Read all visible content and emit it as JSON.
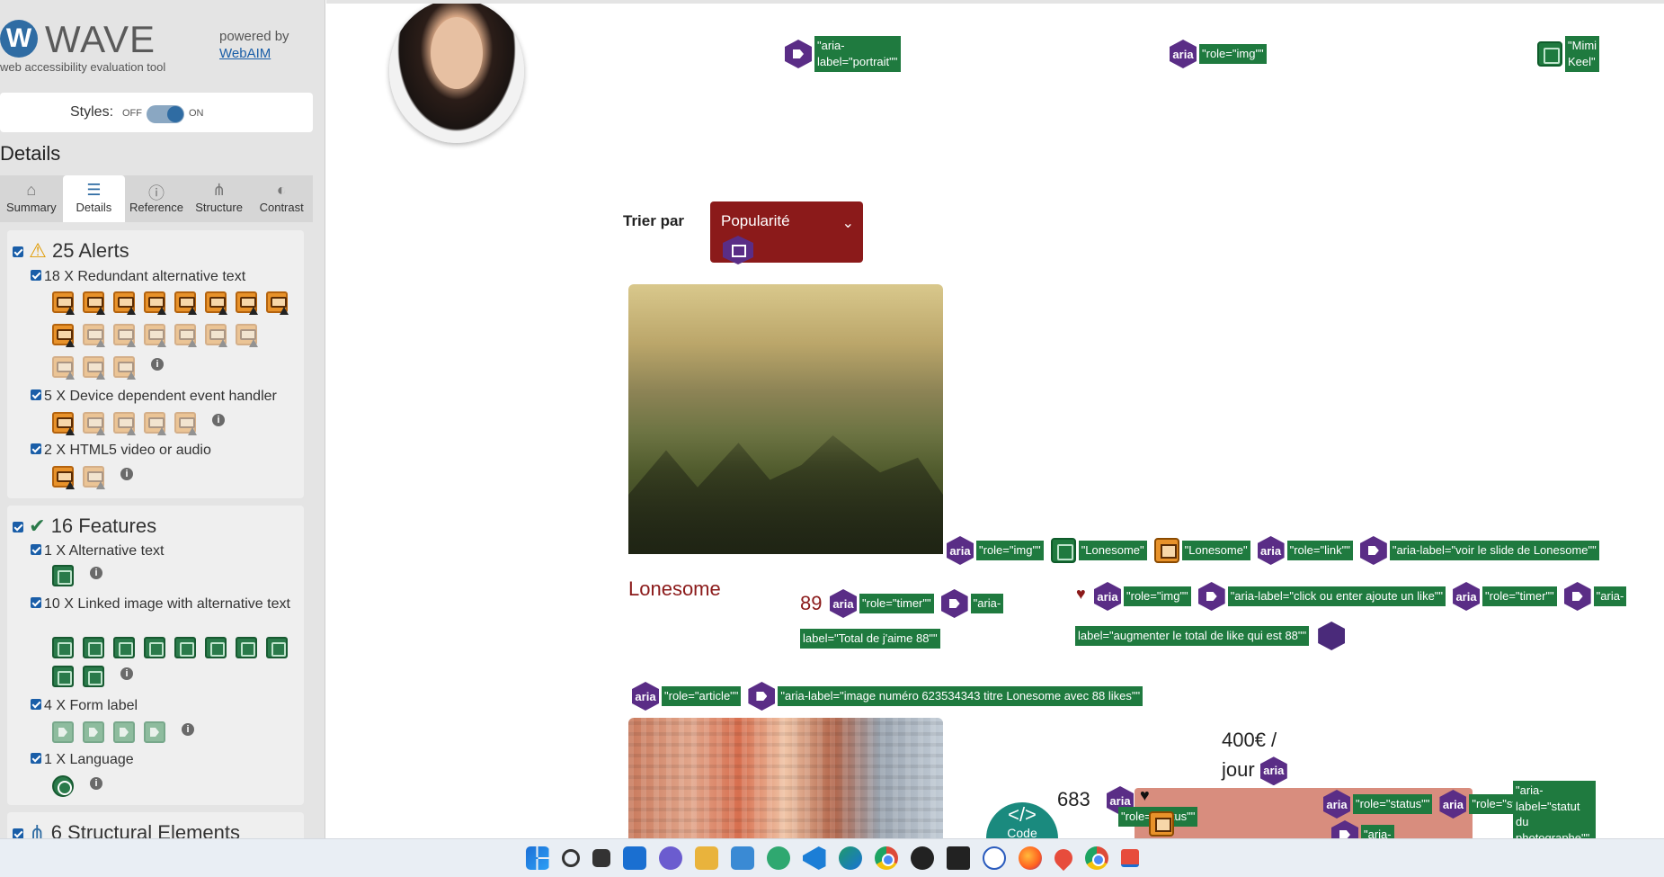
{
  "wave": {
    "name": "WAVE",
    "tagline": "web accessibility evaluation tool",
    "powered_by": "powered by",
    "webaim": "WebAIM",
    "styles_label": "Styles:",
    "styles_off": "OFF",
    "styles_on": "ON",
    "section_title": "Details",
    "tabs": [
      {
        "label": "Summary",
        "icon": "home-icon"
      },
      {
        "label": "Details",
        "icon": "list-icon",
        "active": true
      },
      {
        "label": "Reference",
        "icon": "info-icon"
      },
      {
        "label": "Structure",
        "icon": "structure-icon"
      },
      {
        "label": "Contrast",
        "icon": "contrast-icon"
      }
    ],
    "alerts_title": "25 Alerts",
    "alert_items": [
      {
        "label": "18 X Redundant alternative text",
        "count": 18
      },
      {
        "label": "5 X Device dependent event handler",
        "count": 5
      },
      {
        "label": "2 X HTML5 video or audio",
        "count": 2
      }
    ],
    "features_title": "16 Features",
    "feature_items": [
      {
        "label": "1 X Alternative text",
        "count": 1
      },
      {
        "label": "10 X Linked image with alternative text",
        "count": 10
      },
      {
        "label": "4 X Form label",
        "count": 4
      },
      {
        "label": "1 X Language",
        "count": 1
      }
    ],
    "structural_title": "6 Structural Elements"
  },
  "page": {
    "sort_label": "Trier par",
    "sort_value": "Popularité",
    "card1_title": "Lonesome",
    "card1_likes": "89",
    "card2_price": "400€ /",
    "card2_price_unit": "jour",
    "card2_likes": "683",
    "code_label": "Code"
  },
  "badges": {
    "aria": "aria",
    "portrait": "\"aria-label=\"portrait\"\"",
    "role_img": "\"role=\"img\"\"",
    "mimi": "\"Mimi Keel\"",
    "lonesome_alt": "\"Lonesome\"",
    "role_link": "\"role=\"link\"\"",
    "voir_slide": "\"aria-label=\"voir le slide de Lonesome\"\"",
    "role_timer": "\"role=\"timer\"\"",
    "aria_dash": "\"aria-",
    "total_like": "label=\"Total de j'aime 88\"\"",
    "click_like": "\"aria-label=\"click ou enter ajoute un like\"\"",
    "augmenter": "label=\"augmenter le total de like qui est 88\"\"",
    "role_article": "\"role=\"article\"\"",
    "image_numero": "\"aria-label=\"image numéro 623534343 titre Lonesome avec 88 likes\"\"",
    "role_status": "\"role=\"status\"\"",
    "aria_label_statut": "\"aria-label=\"statut du photographe\"\""
  },
  "taskbar": [
    "start",
    "search",
    "task-view",
    "widgets",
    "chat",
    "file-explorer",
    "desktop",
    "atom",
    "vscode",
    "edge",
    "chrome",
    "chatgpt",
    "terminal",
    "word",
    "firefox",
    "maps",
    "chrome",
    "snipping-tool"
  ]
}
